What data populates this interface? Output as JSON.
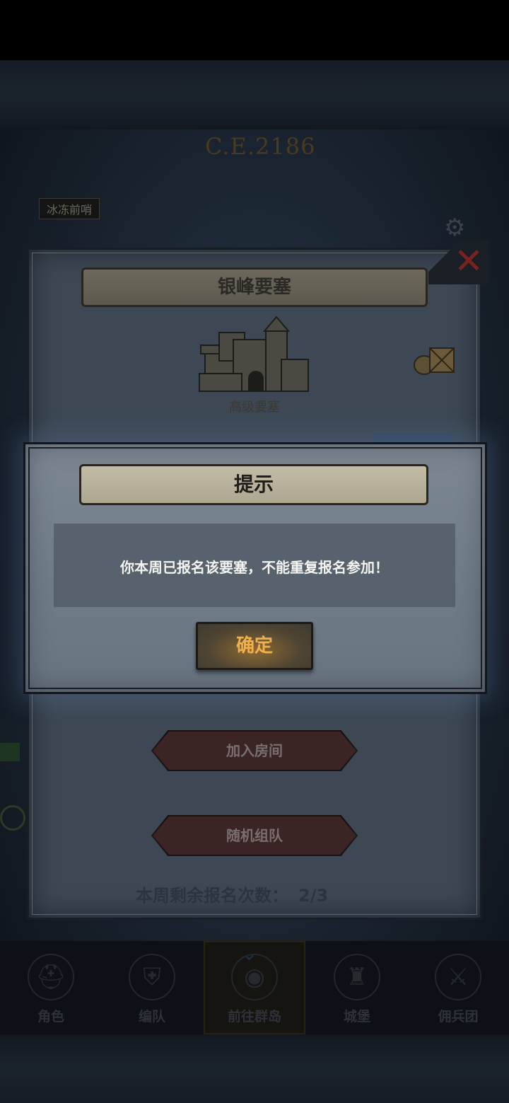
{
  "header": {
    "era": "C.E.2186",
    "top_left_label": "冰冻前哨"
  },
  "fortress_panel": {
    "title": "银峰要塞",
    "castle_label": "高级要塞",
    "buttons": {
      "join_room": "加入房间",
      "random_team": "随机组队"
    },
    "remaining_label": "本周剩余报名次数：",
    "remaining_value": "2/3"
  },
  "dialog": {
    "title": "提示",
    "message": "你本周已报名该要塞，不能重复报名参加！",
    "ok_label": "确定"
  },
  "bottom_nav": {
    "items": [
      {
        "label": "角色",
        "icon": "helmet-icon"
      },
      {
        "label": "编队",
        "icon": "shield-icon"
      },
      {
        "label": "前往群岛",
        "icon": "island-icon"
      },
      {
        "label": "城堡",
        "icon": "tower-icon"
      },
      {
        "label": "佣兵团",
        "icon": "dragon-icon"
      }
    ]
  },
  "colors": {
    "dialog_bg": "#75818c",
    "parchment": "#b8b19b",
    "ok_text": "#f2b04a",
    "close_red": "#7a2222"
  }
}
